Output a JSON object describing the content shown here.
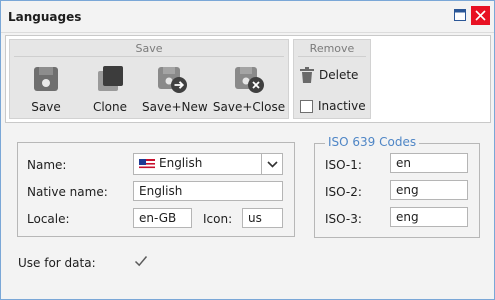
{
  "window": {
    "title": "Languages"
  },
  "ribbon": {
    "save_group": {
      "title": "Save",
      "buttons": [
        {
          "label": "Save",
          "icon": "floppy-disk-icon"
        },
        {
          "label": "Clone",
          "icon": "clone-icon"
        },
        {
          "label": "Save+New",
          "icon": "save-new-icon"
        },
        {
          "label": "Save+Close",
          "icon": "save-close-icon"
        }
      ]
    },
    "remove_group": {
      "title": "Remove",
      "delete_label": "Delete",
      "inactive_label": "Inactive",
      "inactive_checked": false
    }
  },
  "form": {
    "name_label": "Name:",
    "name_value": "English",
    "native_name_label": "Native name:",
    "native_name_value": "English",
    "locale_label": "Locale:",
    "locale_value": "en-GB",
    "icon_label": "Icon:",
    "icon_value": "us",
    "use_for_data_label": "Use for data:",
    "use_for_data_checked": true
  },
  "iso": {
    "legend": "ISO 639 Codes",
    "iso1_label": "ISO-1:",
    "iso1_value": "en",
    "iso2_label": "ISO-2:",
    "iso2_value": "eng",
    "iso3_label": "ISO-3:",
    "iso3_value": "eng"
  },
  "colors": {
    "accent": "#4f86c6",
    "close_button": "#e81123",
    "window_border": "#7aa7d7"
  }
}
